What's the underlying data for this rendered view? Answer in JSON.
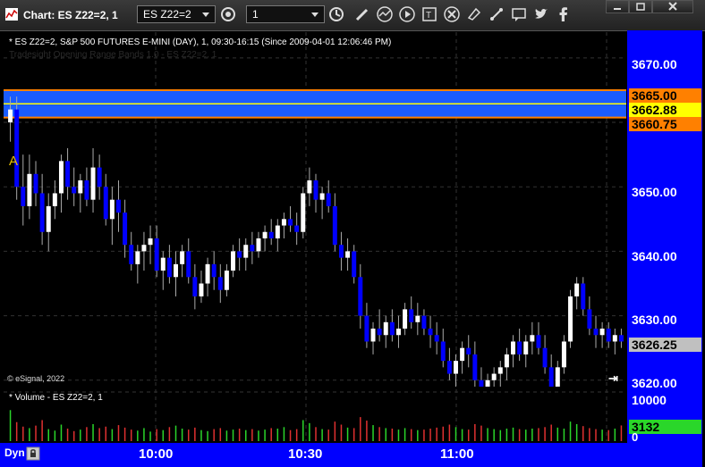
{
  "window": {
    "title": "Chart: ES Z22=2, 1",
    "symbol_combo": "ES Z22=2",
    "interval_combo": "1"
  },
  "toolbar": {
    "icons": [
      "settings-icon",
      "clock-icon",
      "pencil-icon",
      "chart-icon",
      "play-icon",
      "text-tool-icon",
      "clear-icon",
      "eraser-icon",
      "comment-icon",
      "twitter-icon",
      "facebook-icon"
    ]
  },
  "chart": {
    "header": "* ES Z22=2, S&P 500 FUTURES E-MINI (DAY), 1, 09:30-16:15 (Since 2009-04-01 12:06:46 PM)",
    "study_label": "Tradesight Opening Range Bands 1.0 - ES Z22=2, 1",
    "watermark": "© eSignal, 2022",
    "marker": "A",
    "y_labels": [
      "3670.00",
      "3650.00",
      "3640.00",
      "3630.00",
      "3620.00"
    ],
    "band_high": "3665.00",
    "band_mid": "3662.88",
    "band_low": "3660.75",
    "last_price": "3626.25",
    "colors": {
      "up": "#ffffff",
      "down": "#0000ff",
      "band": "#1a5cff",
      "band_edge": "#ff8000",
      "mid": "#ffff00",
      "axis": "#0000ff"
    }
  },
  "volume": {
    "header": "* Volume - ES Z22=2, 1",
    "y_label": "10000",
    "last_volume": "3132",
    "zero": "0"
  },
  "xaxis": {
    "dyn": "Dyn",
    "labels": [
      "10:00",
      "10:30",
      "11:00"
    ]
  },
  "chart_data": {
    "type": "candlestick",
    "price_range": [
      3619,
      3674
    ],
    "bars": [
      [
        3660,
        3664,
        3657,
        3662
      ],
      [
        3662,
        3664,
        3648,
        3650
      ],
      [
        3650,
        3655,
        3644,
        3647
      ],
      [
        3647,
        3655,
        3645,
        3652
      ],
      [
        3652,
        3654,
        3647,
        3649
      ],
      [
        3649,
        3652,
        3641,
        3643
      ],
      [
        3643,
        3649,
        3640,
        3647
      ],
      [
        3647,
        3651,
        3645,
        3649
      ],
      [
        3649,
        3655,
        3646,
        3654
      ],
      [
        3654,
        3656,
        3648,
        3650
      ],
      [
        3650,
        3653,
        3647,
        3649
      ],
      [
        3649,
        3652,
        3646,
        3651
      ],
      [
        3651,
        3653,
        3647,
        3648
      ],
      [
        3648,
        3656,
        3646,
        3653
      ],
      [
        3653,
        3655,
        3648,
        3650
      ],
      [
        3650,
        3652,
        3644,
        3645
      ],
      [
        3645,
        3650,
        3641,
        3648
      ],
      [
        3648,
        3651,
        3643,
        3646
      ],
      [
        3646,
        3648,
        3639,
        3641
      ],
      [
        3641,
        3643,
        3637,
        3638
      ],
      [
        3638,
        3641,
        3635,
        3640
      ],
      [
        3640,
        3643,
        3637,
        3641
      ],
      [
        3641,
        3644,
        3638,
        3642
      ],
      [
        3642,
        3644,
        3636,
        3637
      ],
      [
        3637,
        3640,
        3634,
        3639
      ],
      [
        3639,
        3641,
        3635,
        3636
      ],
      [
        3636,
        3640,
        3633,
        3638
      ],
      [
        3638,
        3641,
        3636,
        3640
      ],
      [
        3640,
        3642,
        3635,
        3636
      ],
      [
        3636,
        3638,
        3631,
        3633
      ],
      [
        3633,
        3637,
        3632,
        3635
      ],
      [
        3635,
        3639,
        3633,
        3638
      ],
      [
        3638,
        3640,
        3634,
        3636
      ],
      [
        3636,
        3638,
        3632,
        3634
      ],
      [
        3634,
        3638,
        3633,
        3637
      ],
      [
        3637,
        3641,
        3636,
        3640
      ],
      [
        3640,
        3642,
        3637,
        3639
      ],
      [
        3639,
        3642,
        3637,
        3641
      ],
      [
        3641,
        3643,
        3638,
        3640
      ],
      [
        3640,
        3643,
        3639,
        3642
      ],
      [
        3642,
        3644,
        3640,
        3643
      ],
      [
        3643,
        3645,
        3641,
        3642
      ],
      [
        3642,
        3645,
        3640,
        3644
      ],
      [
        3644,
        3646,
        3642,
        3645
      ],
      [
        3645,
        3647,
        3643,
        3644
      ],
      [
        3644,
        3646,
        3641,
        3643
      ],
      [
        3643,
        3650,
        3642,
        3649
      ],
      [
        3649,
        3653,
        3647,
        3651
      ],
      [
        3651,
        3652,
        3646,
        3648
      ],
      [
        3648,
        3650,
        3645,
        3649
      ],
      [
        3649,
        3651,
        3646,
        3647
      ],
      [
        3647,
        3649,
        3640,
        3641
      ],
      [
        3641,
        3643,
        3637,
        3639
      ],
      [
        3639,
        3642,
        3637,
        3640
      ],
      [
        3640,
        3641,
        3635,
        3636
      ],
      [
        3636,
        3638,
        3628,
        3630
      ],
      [
        3630,
        3632,
        3625,
        3626
      ],
      [
        3626,
        3629,
        3624,
        3628
      ],
      [
        3628,
        3631,
        3626,
        3627
      ],
      [
        3627,
        3630,
        3625,
        3629
      ],
      [
        3629,
        3631,
        3626,
        3627
      ],
      [
        3627,
        3630,
        3625,
        3628
      ],
      [
        3628,
        3632,
        3627,
        3631
      ],
      [
        3631,
        3633,
        3628,
        3629
      ],
      [
        3629,
        3632,
        3627,
        3630
      ],
      [
        3630,
        3631,
        3627,
        3628
      ],
      [
        3628,
        3630,
        3625,
        3627
      ],
      [
        3627,
        3629,
        3624,
        3626
      ],
      [
        3626,
        3628,
        3622,
        3623
      ],
      [
        3623,
        3625,
        3620,
        3621
      ],
      [
        3621,
        3624,
        3619,
        3623
      ],
      [
        3623,
        3626,
        3621,
        3625
      ],
      [
        3625,
        3627,
        3622,
        3624
      ],
      [
        3624,
        3626,
        3619,
        3620
      ],
      [
        3620,
        3622,
        3618,
        3619
      ],
      [
        3619,
        3621,
        3617,
        3620
      ],
      [
        3620,
        3622,
        3618,
        3621
      ],
      [
        3621,
        3623,
        3619,
        3622
      ],
      [
        3622,
        3625,
        3620,
        3624
      ],
      [
        3624,
        3627,
        3622,
        3626
      ],
      [
        3626,
        3628,
        3623,
        3624
      ],
      [
        3624,
        3627,
        3622,
        3626
      ],
      [
        3626,
        3629,
        3624,
        3627
      ],
      [
        3627,
        3629,
        3624,
        3625
      ],
      [
        3625,
        3627,
        3621,
        3622
      ],
      [
        3622,
        3624,
        3618,
        3619
      ],
      [
        3619,
        3623,
        3618,
        3622
      ],
      [
        3622,
        3627,
        3621,
        3626
      ],
      [
        3626,
        3634,
        3625,
        3633
      ],
      [
        3633,
        3636,
        3631,
        3635
      ],
      [
        3635,
        3636,
        3630,
        3631
      ],
      [
        3631,
        3633,
        3627,
        3628
      ],
      [
        3628,
        3630,
        3625,
        3627
      ],
      [
        3627,
        3629,
        3625,
        3628
      ],
      [
        3628,
        3629,
        3625,
        3626
      ],
      [
        3626,
        3628,
        3624,
        3627
      ],
      [
        3627,
        3628,
        3625,
        3626
      ]
    ],
    "volume": [
      6200,
      3800,
      2900,
      2600,
      3100,
      4200,
      2400,
      2100,
      3300,
      2500,
      2000,
      2300,
      2800,
      3400,
      2600,
      2900,
      2400,
      3200,
      2700,
      2300,
      2100,
      2600,
      1900,
      2400,
      2200,
      2800,
      3100,
      2500,
      2300,
      2700,
      2200,
      2000,
      2400,
      2600,
      2100,
      2300,
      2500,
      2200,
      2400,
      2100,
      2300,
      2600,
      2500,
      2800,
      2200,
      2400,
      4200,
      3600,
      2800,
      2400,
      2300,
      3900,
      3300,
      2700,
      2600,
      4800,
      4100,
      3200,
      2800,
      2600,
      2500,
      2300,
      2600,
      2400,
      2200,
      2300,
      2500,
      2700,
      2900,
      3300,
      2800,
      2400,
      2300,
      3400,
      3100,
      2600,
      2400,
      2200,
      2500,
      2700,
      2400,
      2300,
      2500,
      2600,
      2800,
      3300,
      2700,
      2500,
      3900,
      3400,
      3000,
      2600,
      2400,
      2300,
      2200,
      2500,
      3132
    ]
  }
}
